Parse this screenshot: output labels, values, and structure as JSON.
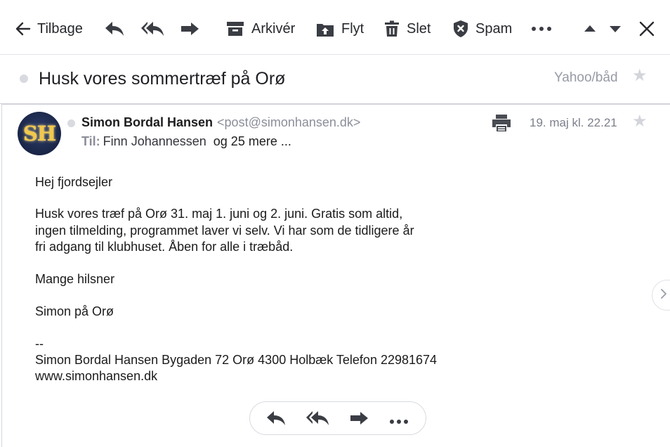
{
  "toolbar": {
    "back_label": "Tilbage",
    "archive_label": "Arkivér",
    "move_label": "Flyt",
    "delete_label": "Slet",
    "spam_label": "Spam"
  },
  "message": {
    "subject": "Husk vores sommertræf på Orø",
    "folder": "Yahoo/båd",
    "avatar_initials": "SH",
    "sender_name": "Simon Bordal Hansen",
    "sender_email": "<post@simonhansen.dk>",
    "to_label": "Til:",
    "to_name": "Finn Johannessen",
    "to_more": "og 25 mere ...",
    "date": "19. maj kl. 22.21",
    "body": {
      "greeting": "Hej fjordsejler",
      "p1_l1": "Husk vores træf på Orø 31. maj 1. juni og 2. juni. Gratis som altid,",
      "p1_l2": "ingen tilmelding, programmet laver vi selv. Vi har som de tidligere år",
      "p1_l3": "fri adgang til klubhuset. Åben for alle i træbåd.",
      "closing": "Mange hilsner",
      "signoff": "Simon på Orø",
      "sig_sep": "--",
      "sig_l1": "Simon Bordal Hansen Bygaden 72 Orø 4300 Holbæk Telefon 22981674",
      "sig_l2": "www.simonhansen.dk"
    }
  },
  "icons": {
    "back": "arrow-left-icon",
    "reply": "reply-icon",
    "reply_all": "reply-all-icon",
    "forward": "forward-icon",
    "archive": "archive-icon",
    "move": "move-icon",
    "delete": "trash-icon",
    "spam": "shield-x-icon",
    "more": "more-dots-icon",
    "prev": "caret-up-icon",
    "next": "caret-down-icon",
    "close": "close-icon",
    "star": "star-icon",
    "print": "printer-icon",
    "next_message": "chevron-right-icon"
  },
  "colors": {
    "text_primary": "#1d1d1f",
    "text_muted": "#8b8e99",
    "star": "#d3d5db",
    "avatar_bg": "#1a2647",
    "avatar_text": "#f2c84b"
  }
}
